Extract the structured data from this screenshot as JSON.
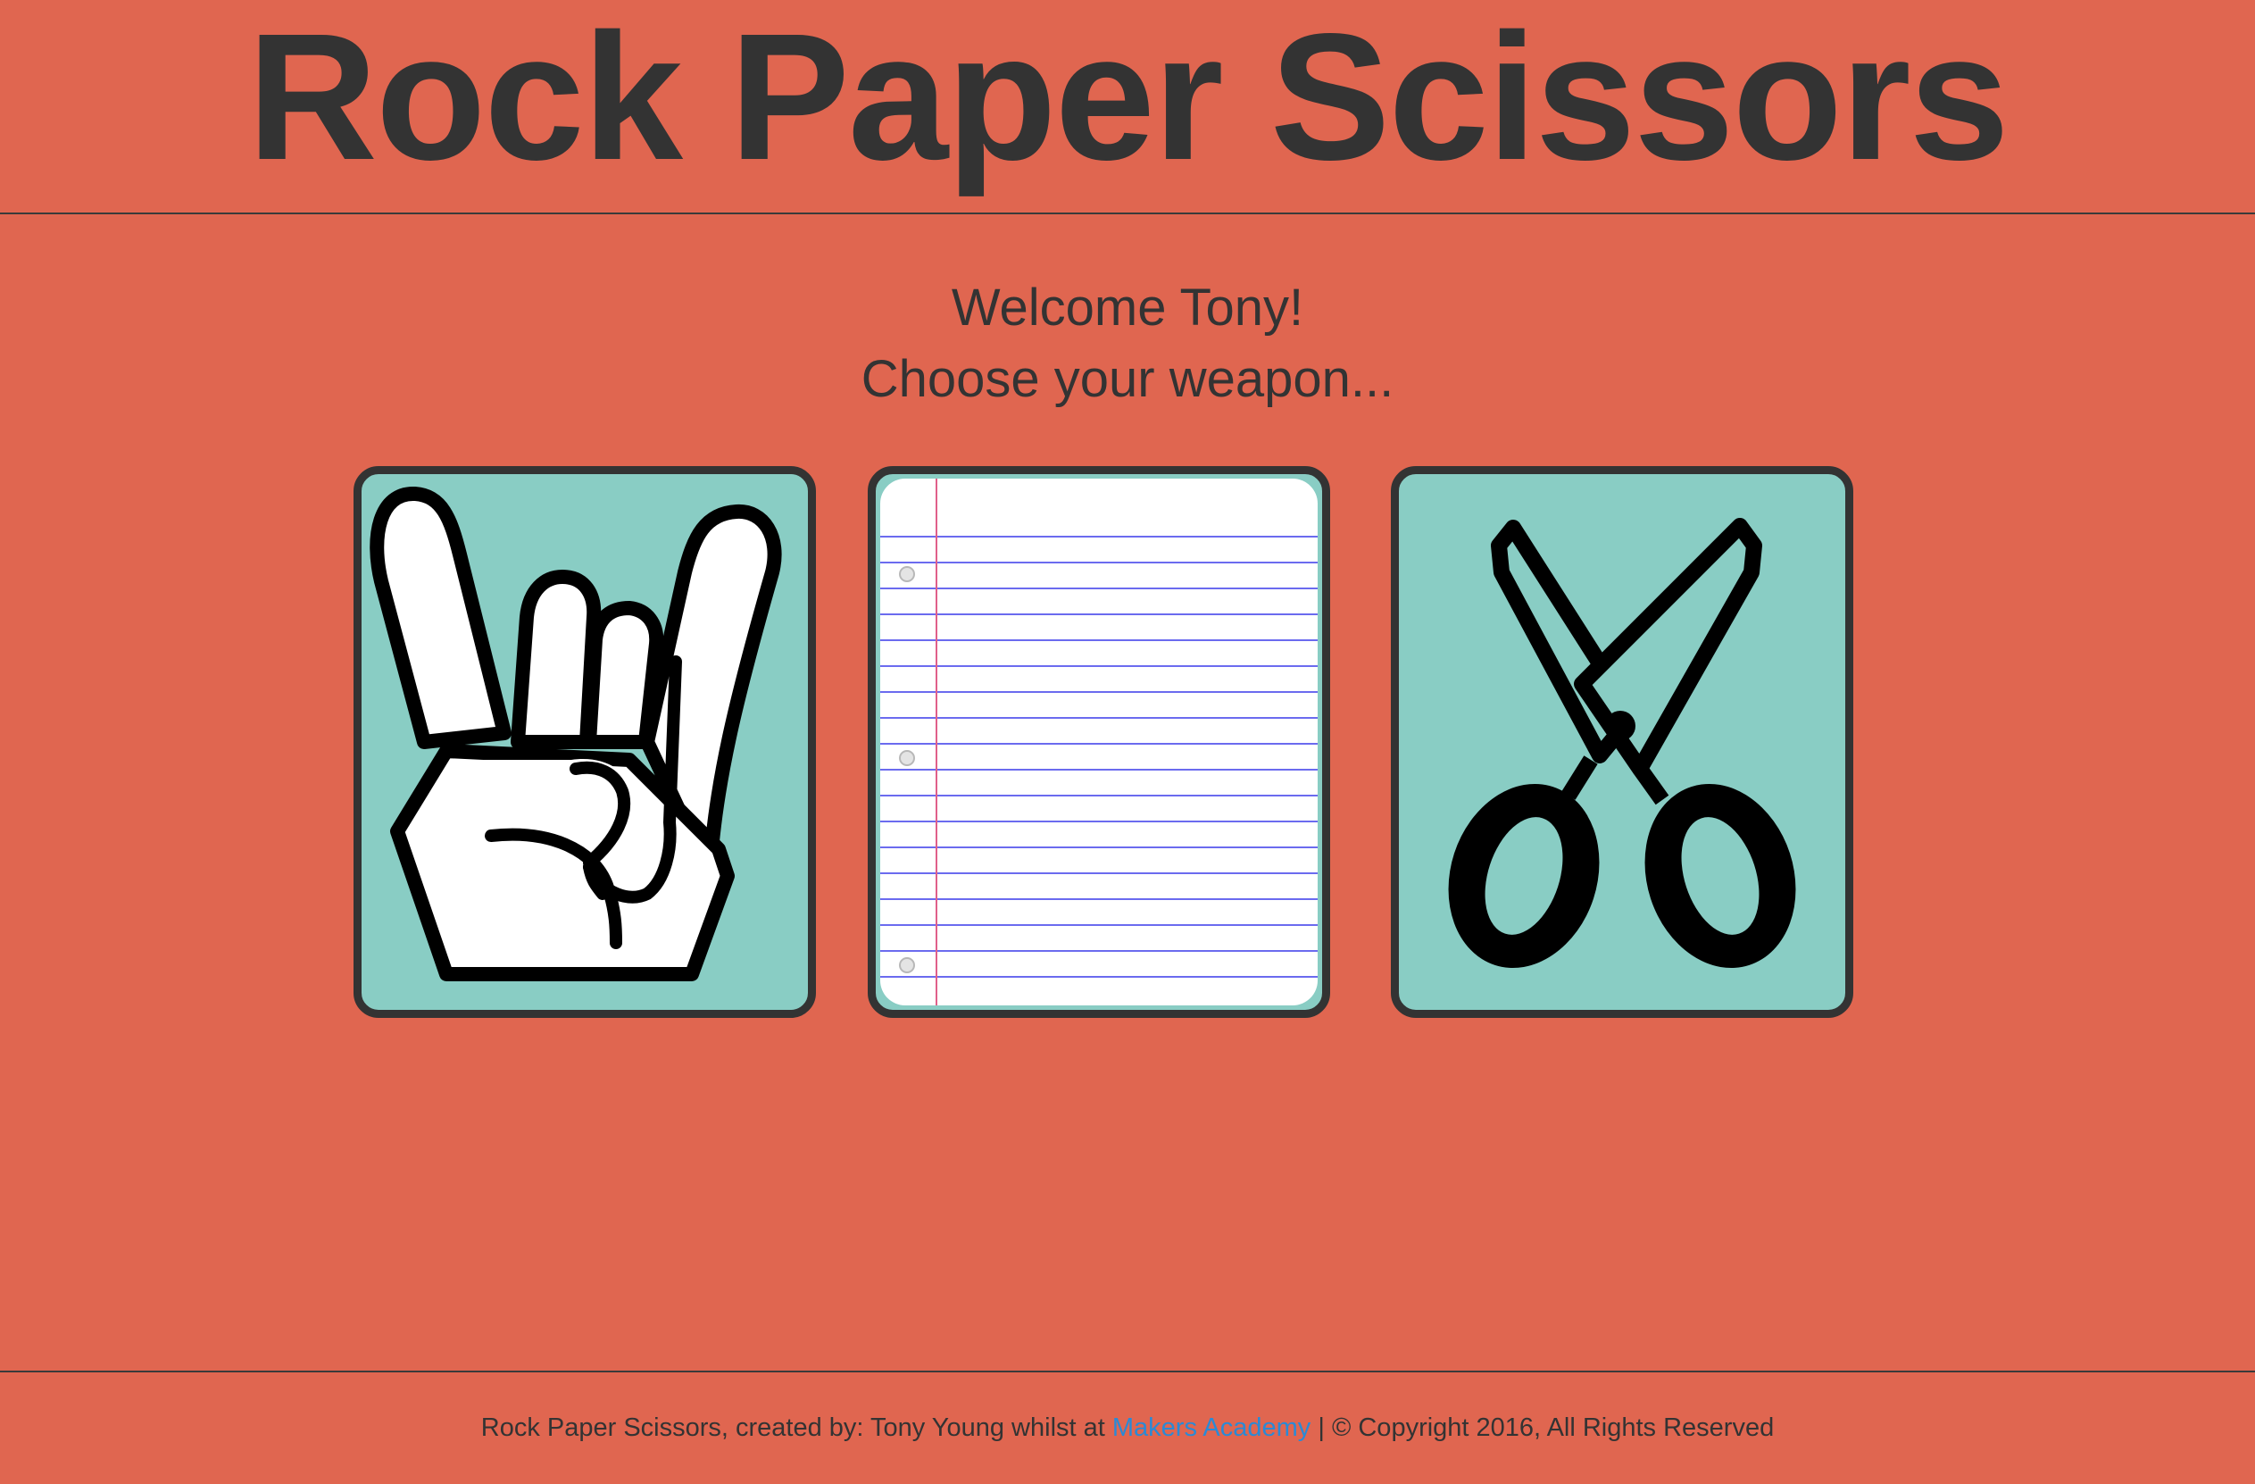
{
  "header": {
    "title": "Rock Paper Scissors"
  },
  "welcome": {
    "greeting": "Welcome Tony!",
    "prompt": "Choose your weapon..."
  },
  "weapons": [
    {
      "id": "rock",
      "icon": "rock-hand-icon"
    },
    {
      "id": "paper",
      "icon": "lined-paper-icon"
    },
    {
      "id": "scissors",
      "icon": "scissors-icon"
    }
  ],
  "footer": {
    "credit": "Rock Paper Scissors, created by: Tony Young whilst at ",
    "link": "Makers Academy",
    "copyright": " | © Copyright 2016, All Rights Reserved"
  },
  "colors": {
    "background": "#e06650",
    "text": "#333333",
    "tile": "#89cdc4",
    "link": "#2a8ad6"
  }
}
